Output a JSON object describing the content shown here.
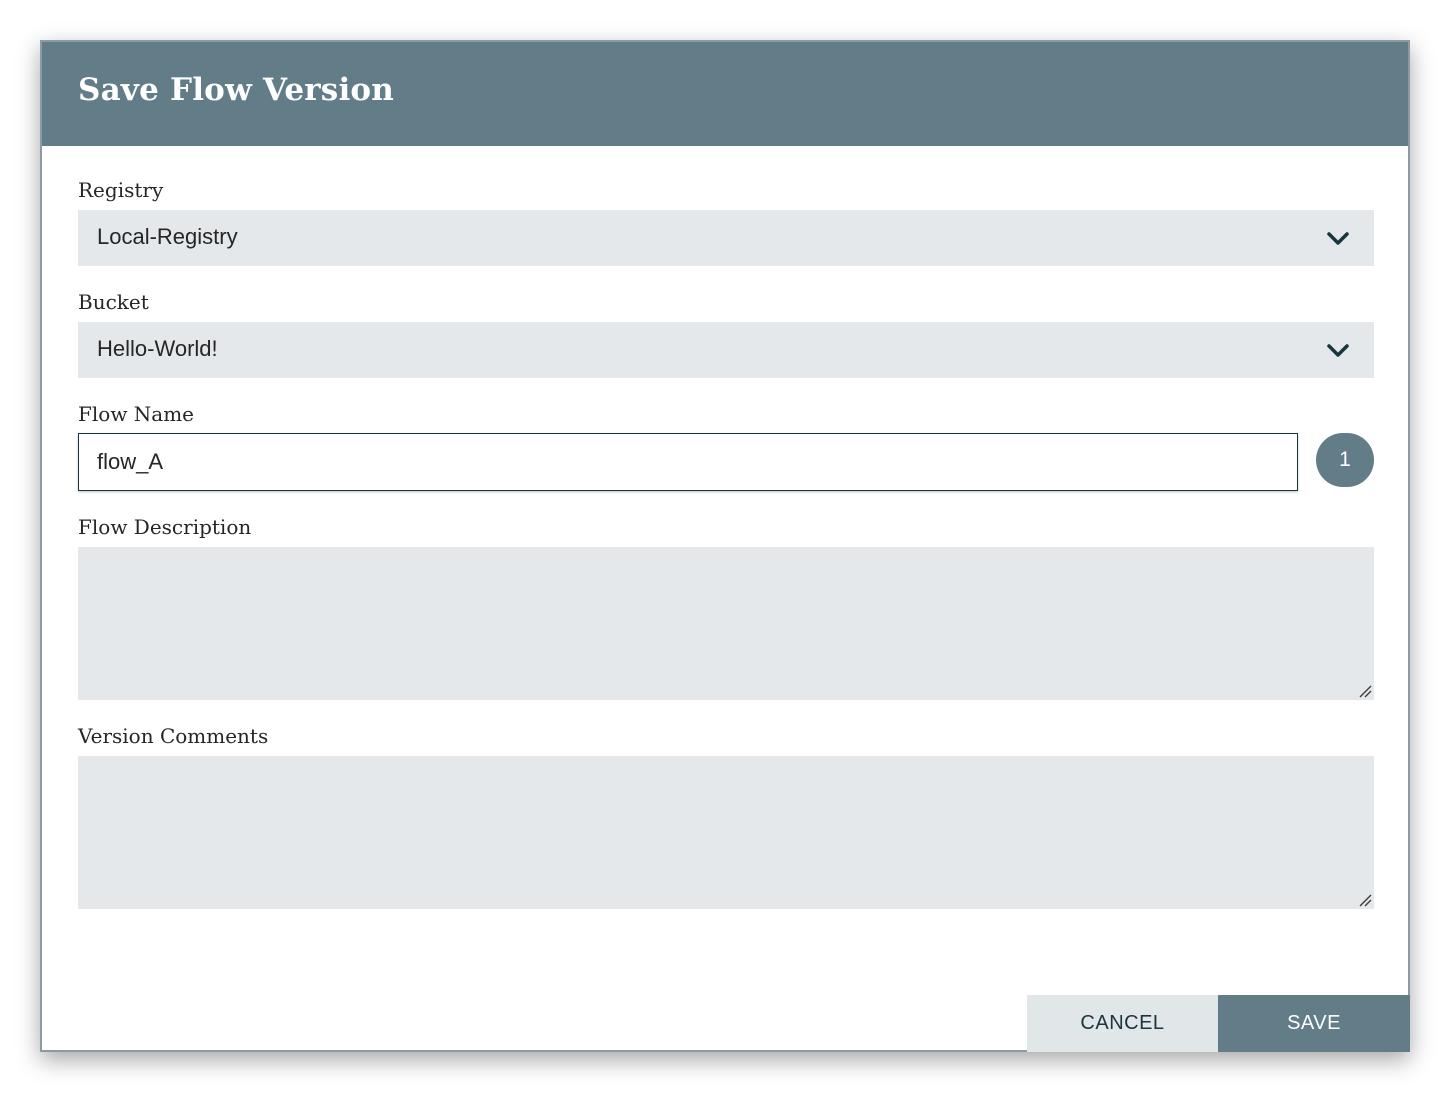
{
  "dialog": {
    "title": "Save Flow Version"
  },
  "fields": {
    "registry": {
      "label": "Registry",
      "value": "Local-Registry"
    },
    "bucket": {
      "label": "Bucket",
      "value": "Hello-World!"
    },
    "flow_name": {
      "label": "Flow Name",
      "value": "flow_A",
      "version_badge": "1"
    },
    "flow_description": {
      "label": "Flow Description",
      "value": ""
    },
    "version_comments": {
      "label": "Version Comments",
      "value": ""
    }
  },
  "buttons": {
    "cancel_label": "CANCEL",
    "save_label": "SAVE"
  },
  "icons": {
    "select_chevron": "chevron-down-icon",
    "textarea_resize": "resize-handle-icon"
  },
  "colors": {
    "header": "#627c88",
    "field_background": "#e4e8eb",
    "cancel_background": "#e1e6e9",
    "save_background": "#627c88",
    "chevron": "#1c343e"
  }
}
